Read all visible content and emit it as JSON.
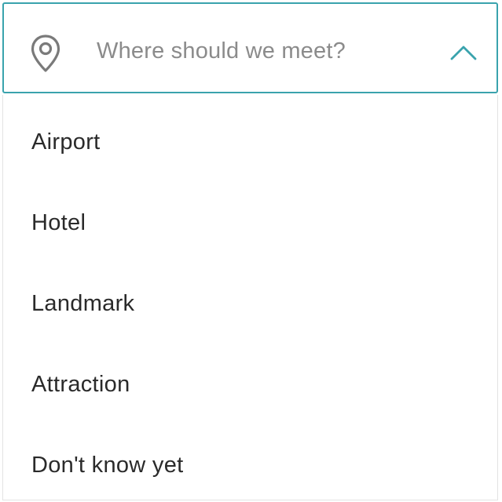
{
  "search": {
    "placeholder": "Where should we meet?",
    "icon": "map-pin-icon",
    "toggle_icon": "chevron-up-icon",
    "accent_color": "#3aa3ad",
    "expanded": true
  },
  "menu": {
    "items": [
      {
        "label": "Airport"
      },
      {
        "label": "Hotel"
      },
      {
        "label": "Landmark"
      },
      {
        "label": "Attraction"
      },
      {
        "label": "Don't know yet"
      }
    ]
  }
}
